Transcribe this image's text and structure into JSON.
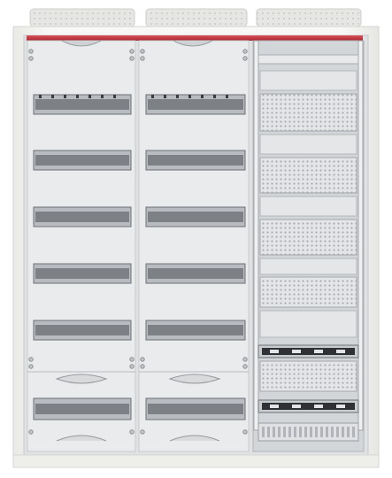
{
  "scene": {
    "subject": "distribution-board-enclosure",
    "left_column": {
      "din_rail_rows": 6,
      "handle_positions": [
        "top",
        "middle",
        "bottom"
      ]
    },
    "middle_column": {
      "din_rail_rows": 6,
      "handle_positions": [
        "top",
        "middle",
        "bottom"
      ]
    },
    "right_column": {
      "perforated_panels": 5,
      "terminal_rails": 2,
      "bottom_terminal_strip": true
    },
    "top_vents": 3
  },
  "colors": {
    "frame": "#f6f6f4",
    "frame_edge": "#dcdcd8",
    "panel": "#e9ebec",
    "panel_dark": "#d3d6d8",
    "rail_slot": "#7d8084",
    "rail_inner": "#b8bcc0",
    "accent_red": "#c8323c",
    "perforation": "#b9bdc1",
    "terminal": "#3a3c3f"
  }
}
